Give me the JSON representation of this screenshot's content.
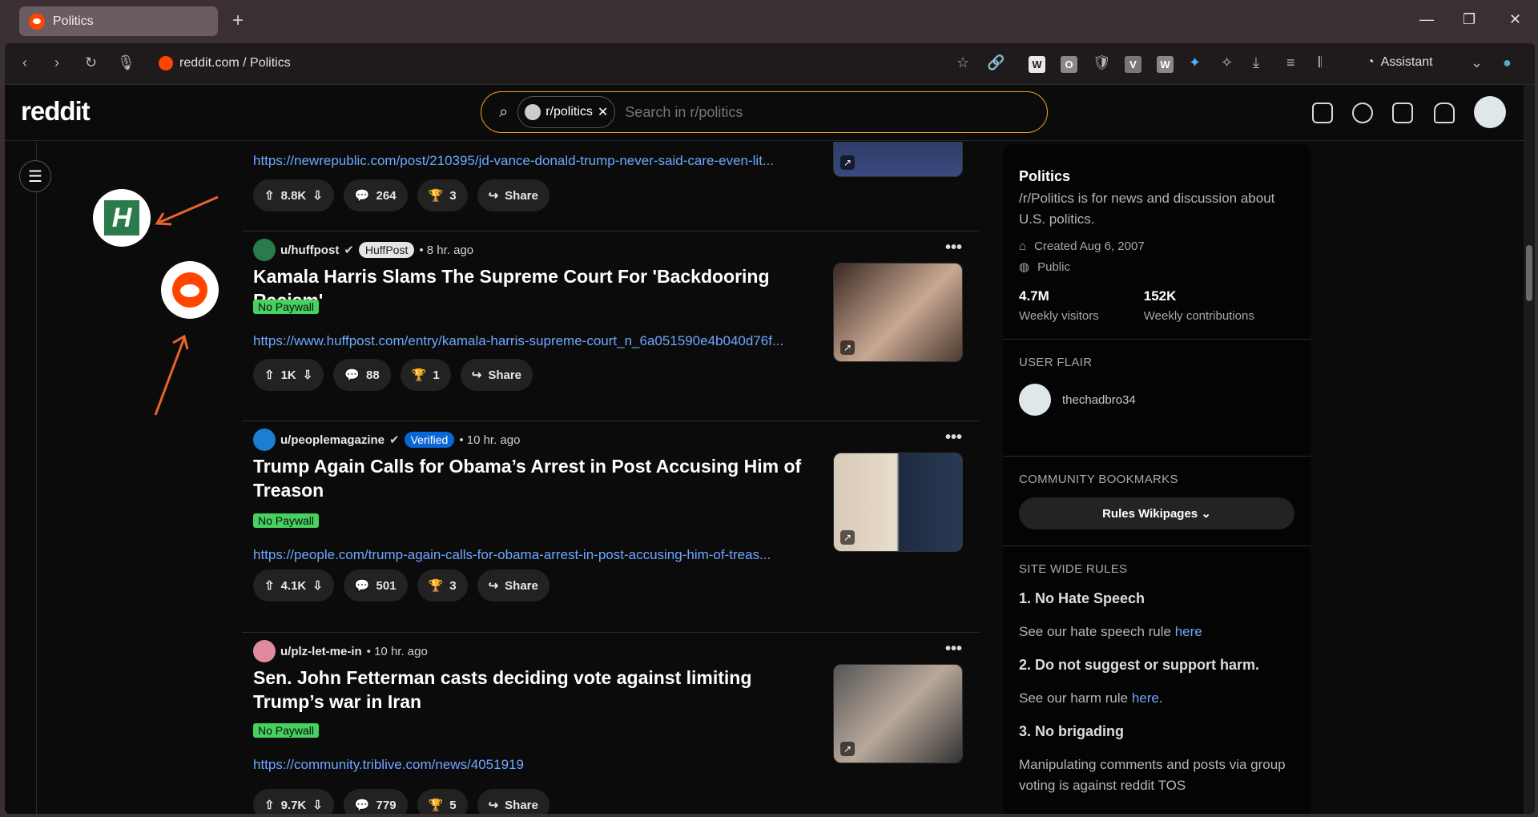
{
  "browser": {
    "tab_title": "Politics",
    "url": "reddit.com / Politics",
    "assistant_label": "Assistant",
    "extensions": [
      "W",
      "O",
      "V",
      "W"
    ]
  },
  "reddit": {
    "logo": "reddit",
    "search_chip": "r/politics",
    "search_placeholder": "Search in r/politics"
  },
  "posts": [
    {
      "author": "",
      "time": "",
      "title": "",
      "link": "https://newrepublic.com/post/210395/jd-vance-donald-trump-never-said-care-even-lit...",
      "votes": "8.8K",
      "comments": "264",
      "award_count": "3",
      "share": "Share"
    },
    {
      "author": "u/huffpost",
      "flair": "HuffPost",
      "time": "• 8 hr. ago",
      "title": "Kamala Harris Slams The Supreme Court For 'Backdooring Racism'",
      "tag": "No Paywall",
      "link": "https://www.huffpost.com/entry/kamala-harris-supreme-court_n_6a051590e4b040d76f...",
      "votes": "1K",
      "comments": "88",
      "award_count": "1",
      "share": "Share"
    },
    {
      "author": "u/peoplemagazine",
      "flair": "Verified",
      "time": "• 10 hr. ago",
      "title": "Trump Again Calls for Obama’s Arrest in Post Accusing Him of Treason",
      "tag": "No Paywall",
      "link": "https://people.com/trump-again-calls-for-obama-arrest-in-post-accusing-him-of-treas...",
      "votes": "4.1K",
      "comments": "501",
      "award_count": "3",
      "share": "Share"
    },
    {
      "author": "u/plz-let-me-in",
      "time": "• 10 hr. ago",
      "title": "Sen. John Fetterman casts deciding vote against limiting Trump’s war in Iran",
      "tag": "No Paywall",
      "link": "https://community.triblive.com/news/4051919",
      "votes": "9.7K",
      "comments": "779",
      "award_count": "5",
      "share": "Share"
    }
  ],
  "sidebar": {
    "name": "Politics",
    "desc": "/r/Politics is for news and discussion about U.S. politics.",
    "created": "Created Aug 6, 2007",
    "visibility": "Public",
    "visitors": "4.7M",
    "visitors_label": "Weekly visitors",
    "contrib": "152K",
    "contrib_label": "Weekly contributions",
    "user_flair_cap": "USER FLAIR",
    "username": "thechadbro34",
    "bookmarks_cap": "COMMUNITY BOOKMARKS",
    "bookmarks_btn": "Rules Wikipages",
    "rules_cap": "SITE WIDE RULES",
    "rule1": "1. No Hate Speech",
    "rule1_desc": "See our hate speech rule",
    "rule2": "2. Do not suggest or support harm.",
    "rule2_desc": "See our harm rule",
    "rule3": "3. No brigading",
    "rule3_desc": "Manipulating comments and posts via group voting is against reddit TOS",
    "here": "here"
  },
  "colors": {
    "accent": "#ff4500",
    "link": "#6ea8ff",
    "no_paywall": "#46d160",
    "annotation_arrow": "#e8642c"
  }
}
